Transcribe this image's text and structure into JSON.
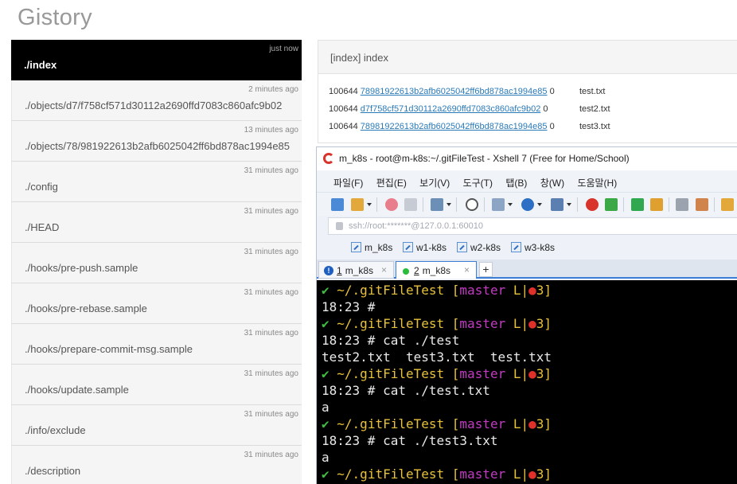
{
  "app": {
    "title": "Gistory"
  },
  "files": [
    {
      "time": "just now",
      "path": "./index",
      "active": true
    },
    {
      "time": "2 minutes ago",
      "path": "./objects/d7/f758cf571d30112a2690ffd7083c860afc9b02"
    },
    {
      "time": "13 minutes ago",
      "path": "./objects/78/981922613b2afb6025042ff6bd878ac1994e85"
    },
    {
      "time": "31 minutes ago",
      "path": "./config"
    },
    {
      "time": "31 minutes ago",
      "path": "./HEAD"
    },
    {
      "time": "31 minutes ago",
      "path": "./hooks/pre-push.sample"
    },
    {
      "time": "31 minutes ago",
      "path": "./hooks/pre-rebase.sample"
    },
    {
      "time": "31 minutes ago",
      "path": "./hooks/prepare-commit-msg.sample"
    },
    {
      "time": "31 minutes ago",
      "path": "./hooks/update.sample"
    },
    {
      "time": "31 minutes ago",
      "path": "./info/exclude"
    },
    {
      "time": "31 minutes ago",
      "path": "./description"
    }
  ],
  "detail": {
    "header": "[index] index",
    "rows": [
      {
        "mode": "100644",
        "sha": "78981922613b2afb6025042ff6bd878ac1994e85",
        "stage": "0",
        "name": "test.txt"
      },
      {
        "mode": "100644",
        "sha": "d7f758cf571d30112a2690ffd7083c860afc9b02",
        "stage": "0",
        "name": "test2.txt"
      },
      {
        "mode": "100644",
        "sha": "78981922613b2afb6025042ff6bd878ac1994e85",
        "stage": "0",
        "name": "test3.txt"
      }
    ]
  },
  "xshell": {
    "title": "m_k8s - root@m-k8s:~/.gitFileTest - Xshell 7 (Free for Home/School)",
    "menu": [
      "파일(F)",
      "편집(E)",
      "보기(V)",
      "도구(T)",
      "탭(B)",
      "창(W)",
      "도움말(H)"
    ],
    "address": "ssh://root:*******@127.0.0.1:60010",
    "quick": [
      "m_k8s",
      "w1-k8s",
      "w2-k8s",
      "w3-k8s"
    ],
    "tabs": [
      {
        "num": "1",
        "label": "m_k8s"
      },
      {
        "num": "2",
        "label": "m_k8s"
      }
    ],
    "add_tab": "+",
    "close_glyph": "×",
    "prompt": {
      "check": "✔",
      "path": "~/.gitFileTest",
      "open": "[",
      "branch": "master",
      "state": "L|",
      "dot": "●",
      "count": "3",
      "close": "]"
    },
    "lines": {
      "l2": "18:23 #",
      "l4": "18:23 # cat ./test",
      "l5": "test2.txt  test3.txt  test.txt",
      "l7": "18:23 # cat ./test.txt",
      "l8": "a",
      "l10": "18:23 # cat ./test3.txt",
      "l11": "a"
    }
  },
  "colors": {
    "terminal_bg": "#000000",
    "prompt_check": "#3fbf3f",
    "prompt_path": "#e8c23c",
    "prompt_branch": "#c33bc3",
    "prompt_dot": "#e0302a",
    "link": "#2a7ab8",
    "tab_accent": "#3a7fd5"
  }
}
